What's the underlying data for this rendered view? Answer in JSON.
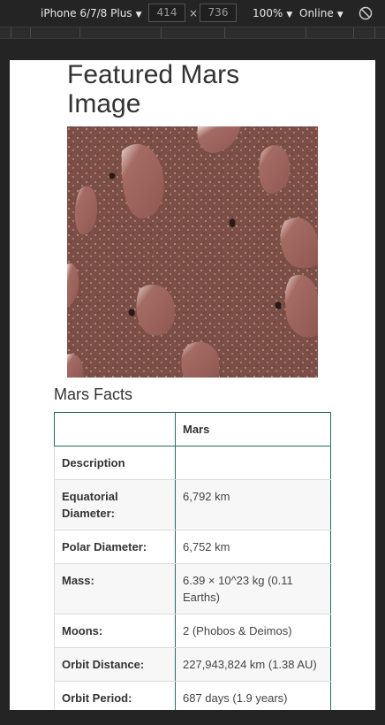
{
  "devtools": {
    "device": "iPhone 6/7/8 Plus",
    "width": "414",
    "height": "736",
    "zoom": "100%",
    "network": "Online",
    "rotate_icon": "rotate-icon"
  },
  "page": {
    "title": "Featured Mars Image",
    "facts_title": "Mars Facts"
  },
  "facts": {
    "header": [
      "",
      "Mars"
    ],
    "rows": [
      {
        "label": "Description",
        "value": ""
      },
      {
        "label": "Equatorial Diameter:",
        "value": "6,792 km"
      },
      {
        "label": "Polar Diameter:",
        "value": "6,752 km"
      },
      {
        "label": "Mass:",
        "value": "6.39 × 10^23 kg (0.11 Earths)"
      },
      {
        "label": "Moons:",
        "value": "2 (Phobos & Deimos)"
      },
      {
        "label": "Orbit Distance:",
        "value": "227,943,824 km (1.38 AU)"
      },
      {
        "label": "Orbit Period:",
        "value": "687 days (1.9 years)"
      }
    ]
  },
  "colors": {
    "accent": "#2b6a66",
    "mars_surface": "#7a4d45"
  }
}
